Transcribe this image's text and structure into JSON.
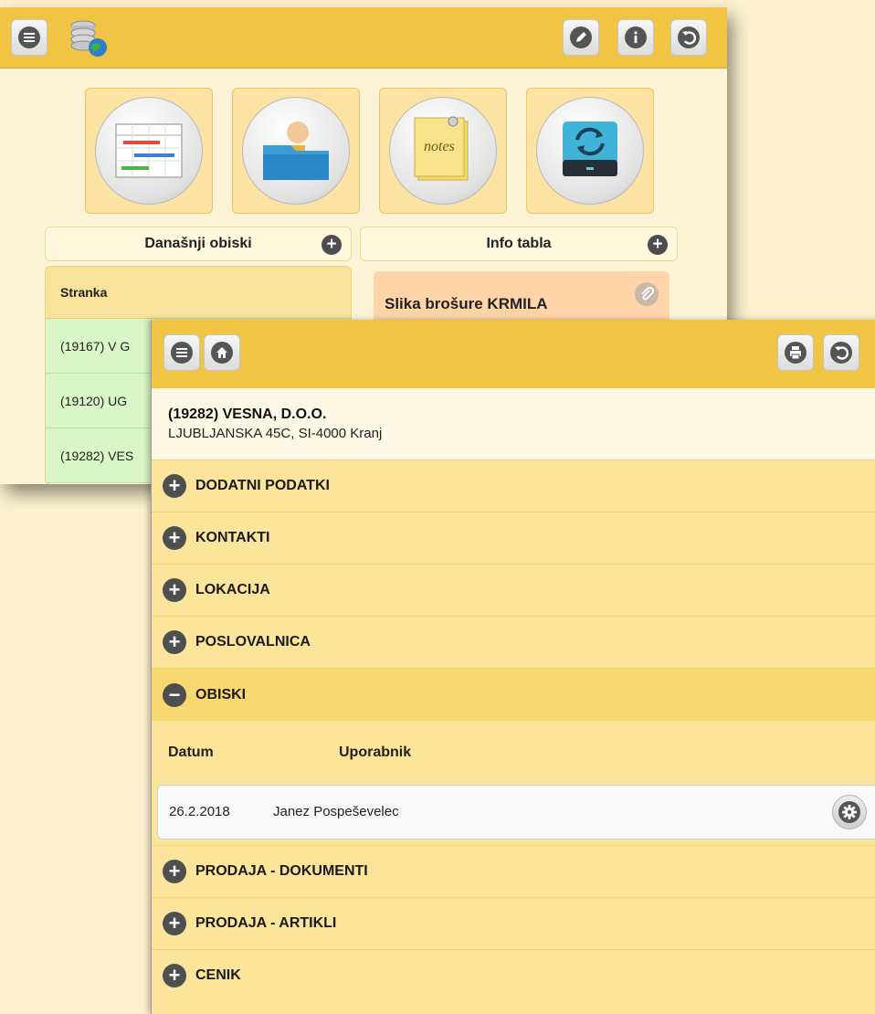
{
  "back_window": {
    "sections": {
      "today_visits": {
        "title": "Današnji obiski"
      },
      "info_board": {
        "title": "Info tabla"
      }
    },
    "table": {
      "header": "Stranka",
      "rows": [
        "(19167) V G",
        "(19120) UG",
        "(19282) VES"
      ]
    },
    "note": {
      "title": "Slika brošure KRMILA"
    }
  },
  "front_window": {
    "customer": {
      "name": "(19282) VESNA, D.O.O.",
      "address": "LJUBLJANSKA 45C, SI-4000 Kranj"
    },
    "sections_before": [
      {
        "label": "DODATNI PODATKI",
        "state": "collapsed"
      },
      {
        "label": "KONTAKTI",
        "state": "collapsed"
      },
      {
        "label": "LOKACIJA",
        "state": "collapsed"
      },
      {
        "label": "POSLOVALNICA",
        "state": "collapsed"
      }
    ],
    "open_section": {
      "label": "OBISKI",
      "state": "expanded"
    },
    "visits": {
      "col_date": "Datum",
      "col_user": "Uporabnik",
      "rows": [
        {
          "date": "26.2.2018",
          "user": "Janez Pospeševelec"
        }
      ]
    },
    "sections_after": [
      {
        "label": "PRODAJA - DOKUMENTI",
        "state": "collapsed"
      },
      {
        "label": "PRODAJA - ARTIKLI",
        "state": "collapsed"
      },
      {
        "label": "CENIK",
        "state": "collapsed"
      }
    ]
  },
  "icons": {
    "plus": "+",
    "minus": "−"
  },
  "colors": {
    "toolbar": "#f2c443",
    "background": "#fdf1cf",
    "row_green": "#d9f6c6",
    "note_orange": "#ffd4a8"
  }
}
